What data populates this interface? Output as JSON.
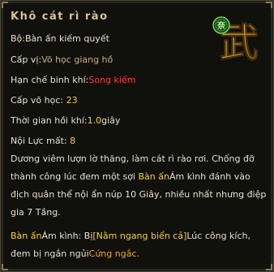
{
  "title": "Khô cát rì rào",
  "colors": {
    "background": "#10100d",
    "border": "#4a4638",
    "title": "#d6c296",
    "text": "#e7e1cf",
    "highlight_yellow": "#f4d23a",
    "highlight_red": "#ff3a3a",
    "highlight_orange": "#f0a81e",
    "weapon_type": "#c9b07e"
  },
  "emblem": {
    "icon": "wu-martial-emblem",
    "character": "武",
    "badge_character": "奈"
  },
  "book": {
    "label": "Bộ:",
    "value": "Bàn ấn kiếm quyết"
  },
  "level_requirement": {
    "label": "Cấp vị:",
    "value": "Võ học giang hồ"
  },
  "weapon_restriction": {
    "label": "Hạn chế binh khí:",
    "value": "Song kiếm"
  },
  "martial_level": {
    "label": "Cấp võ học:",
    "value": "23"
  },
  "cooldown": {
    "label": "Thời gian hồi khí:",
    "value": "1.0",
    "unit": "giây"
  },
  "internal_cost": {
    "label": "Nội Lực mất:",
    "value": "8"
  },
  "description": {
    "part1": "Dương viêm lượn lờ thăng, làm cát rì rào rơi. Chống đỡ thành công lúc đem một sợi",
    "highlight": "Bàn ấn",
    "part2": "Ám kình đánh vào địch quân thể nội ẩn núp 10 Giây, nhiều nhất nhưng điệp gia 7 Tầng."
  },
  "effect": {
    "name": "Bàn ấn",
    "mid1": "Ám kình: Bị",
    "status": "[Nằm ngang biển cả]",
    "mid2": "Lúc công kích, đem bị ngắn ngủi",
    "result": "Cứng ngắc."
  }
}
